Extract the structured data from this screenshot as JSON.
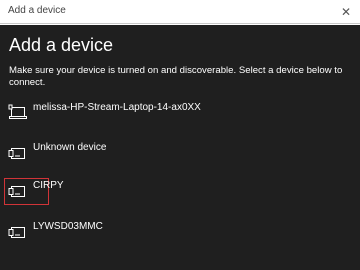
{
  "window": {
    "title": "Add a device",
    "close_glyph": "✕"
  },
  "header": {
    "heading": "Add a device",
    "description": "Make sure your device is turned on and discoverable. Select a device below to connect."
  },
  "devices": [
    {
      "label": "melissa-HP-Stream-Laptop-14-ax0XX",
      "icon": "laptop-icon"
    },
    {
      "label": "Unknown device",
      "icon": "device-icon"
    },
    {
      "label": "CIRPY",
      "icon": "device-icon",
      "selected": true
    },
    {
      "label": "LYWSD03MMC",
      "icon": "device-icon"
    }
  ],
  "colors": {
    "panel_background": "#1f1f1f",
    "selection_border": "#d13438"
  }
}
